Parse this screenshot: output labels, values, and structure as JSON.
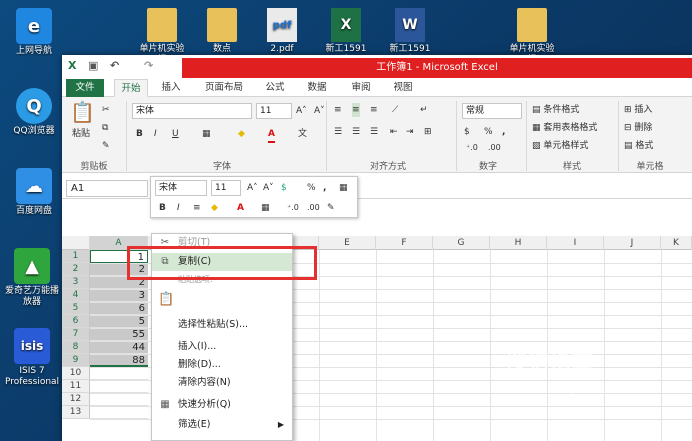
{
  "desktop": {
    "icons": [
      {
        "label": "上网导航",
        "glyph": "e",
        "color": "#1f87e0"
      },
      {
        "label": "QQ浏览器",
        "glyph": "Q",
        "color": "#2b9be6"
      },
      {
        "label": "百度网盘",
        "glyph": "☁",
        "color": "#2f8fe5"
      },
      {
        "label": "爱奇艺万能播放器",
        "glyph": "▲",
        "color": "#2fa53d"
      },
      {
        "label": "ISIS 7 Professional",
        "glyph": "isis",
        "color": "#2a5bd7"
      }
    ],
    "files": [
      {
        "label": "单片机实验报",
        "glyph": "📁",
        "color": "#e8c15a"
      },
      {
        "label": "数点",
        "glyph": "📁",
        "color": "#e8c15a"
      },
      {
        "label": "2.pdf",
        "glyph": "pdf",
        "color": "#eaeaea"
      },
      {
        "label": "新工1591小",
        "glyph": "X",
        "color": "#1e7145"
      },
      {
        "label": "新工1591小",
        "glyph": "W",
        "color": "#2b579a"
      },
      {
        "label": "单片机实验报",
        "glyph": "📁",
        "color": "#e8c15a"
      }
    ]
  },
  "excel": {
    "title": "工作簿1 - Microsoft Excel",
    "tabs": [
      "文件",
      "开始",
      "插入",
      "页面布局",
      "公式",
      "数据",
      "审阅",
      "视图"
    ],
    "active_tab": "开始",
    "ribbon": {
      "clipboard": {
        "paste": "粘贴",
        "label": "剪贴板"
      },
      "font": {
        "name": "宋体",
        "size": "11",
        "label": "字体",
        "bold": "B",
        "italic": "I",
        "underline": "U",
        "grow": "A˄",
        "shrink": "A˅",
        "font_color": "A"
      },
      "alignment": {
        "label": "对齐方式"
      },
      "number": {
        "format": "常规",
        "label": "数字",
        "percent": "%",
        "comma": ","
      },
      "styles": {
        "conditional": "条件格式",
        "table": "套用表格格式",
        "cell": "单元格样式",
        "label": "样式"
      },
      "cells": {
        "insert": "插入",
        "delete": "删除",
        "format": "格式",
        "label": "单元格"
      }
    },
    "name_box": "A1",
    "columns": [
      "A",
      "B",
      "C",
      "D",
      "E",
      "F",
      "G",
      "H",
      "I",
      "J",
      "K"
    ],
    "rows": [
      "1",
      "2",
      "3",
      "4",
      "5",
      "6",
      "7",
      "8",
      "9",
      "10",
      "11",
      "12",
      "13"
    ],
    "column_a_values": [
      "1",
      "2",
      "2",
      "3",
      "6",
      "5",
      "55",
      "44",
      "88",
      "",
      "",
      "",
      ""
    ],
    "minibar": {
      "font": "宋体",
      "size": "11",
      "bold": "B",
      "italic": "I",
      "percent": "%",
      "comma": ","
    }
  },
  "context_menu": {
    "items": [
      {
        "label": "剪切(T)",
        "icon": "✂"
      },
      {
        "label": "复制(C)",
        "icon": "⧉",
        "highlighted": true
      },
      {
        "label": "粘贴选项:",
        "icon": ""
      },
      {
        "label": "",
        "icon": "📋"
      },
      {
        "label": "选择性粘贴(S)...",
        "icon": ""
      },
      {
        "label": "插入(I)...",
        "icon": ""
      },
      {
        "label": "删除(D)...",
        "icon": ""
      },
      {
        "label": "清除内容(N)",
        "icon": ""
      },
      {
        "label": "快速分析(Q)",
        "icon": "▦"
      },
      {
        "label": "筛选(E)",
        "icon": ""
      }
    ]
  },
  "watermark": {
    "text": "搜狗指南",
    "sub": "zhinan.sogou.com"
  }
}
